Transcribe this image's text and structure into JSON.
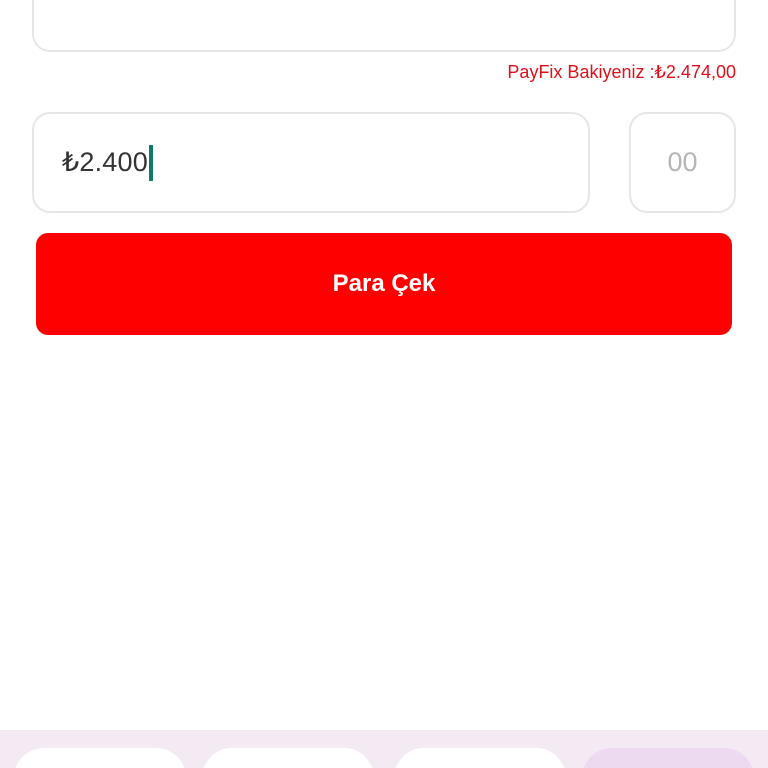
{
  "balance": {
    "label": "PayFix Bakiyeniz :₺2.474,00"
  },
  "amount": {
    "value": "₺2.400"
  },
  "cents": {
    "placeholder": "00"
  },
  "withdraw_button": {
    "label": "Para Çek"
  },
  "colors": {
    "accent": "#ff0000",
    "balance_text": "#e0101a",
    "caret": "#0f7a6a",
    "bottom_bar": "#f3eaf4"
  }
}
